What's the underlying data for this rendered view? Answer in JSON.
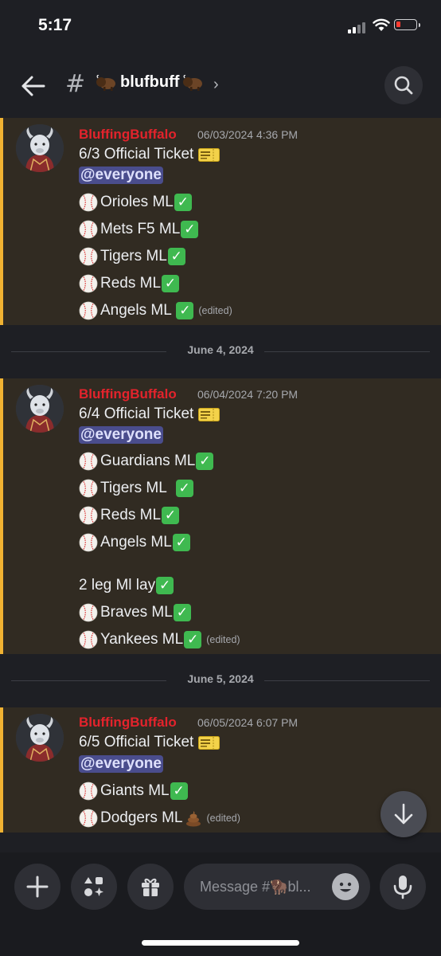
{
  "status_bar": {
    "time": "5:17"
  },
  "header": {
    "channel_name": "blufbuff",
    "chevron": "›"
  },
  "icons": {
    "back": "arrow-left-icon",
    "hash": "hash-icon",
    "search": "search-icon",
    "add": "plus-icon",
    "apps": "apps-icon",
    "gift": "gift-icon",
    "emoji": "emoji-icon",
    "mic": "microphone-icon",
    "jump": "arrow-down-icon"
  },
  "colors": {
    "author": "#e3232c",
    "highlight_bar": "#f0b232",
    "highlight_bg": "#312b22",
    "mention_bg": "#4a4d8d",
    "check": "#3fb950",
    "background": "#1e1f24"
  },
  "messages": [
    {
      "author": "BluffingBuffalo",
      "timestamp": "06/03/2024 4:36 PM",
      "title": "6/3 Official Ticket",
      "mention": "@everyone",
      "edited": "(edited)",
      "picks": [
        "Orioles ML",
        "Mets F5 ML",
        "Tigers ML",
        "Reds ML",
        "Angels ML "
      ]
    },
    {
      "author": "BluffingBuffalo",
      "timestamp": "06/04/2024 7:20 PM",
      "title": "6/4 Official Ticket",
      "mention": "@everyone",
      "edited": "(edited)",
      "picks": [
        "Guardians ML",
        "Tigers ML  ",
        "Reds ML",
        "Angels ML"
      ],
      "sub_title": "2 leg Ml lay",
      "sub_picks": [
        "Braves ML",
        "Yankees ML"
      ]
    },
    {
      "author": "BluffingBuffalo",
      "timestamp": "06/05/2024 6:07 PM",
      "title": "6/5 Official Ticket",
      "mention": "@everyone",
      "edited": "(edited)",
      "picks": [
        "Giants ML",
        "Dodgers ML"
      ]
    }
  ],
  "dividers": [
    "June 4, 2024",
    "June 5, 2024"
  ],
  "composer": {
    "placeholder": "Message #🦬bl..."
  }
}
